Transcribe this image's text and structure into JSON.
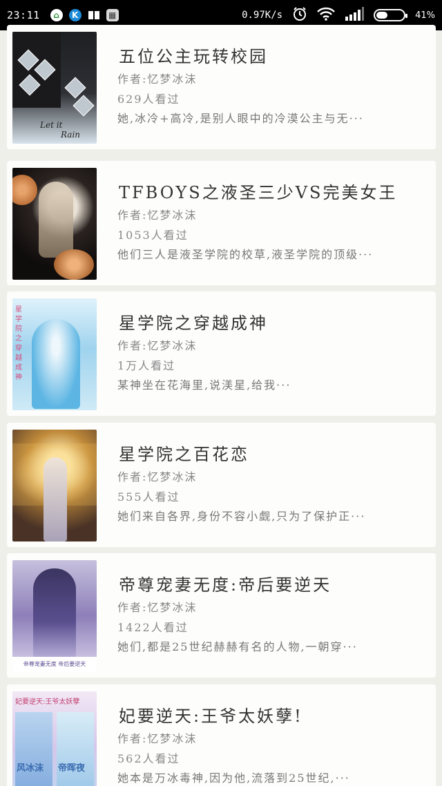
{
  "status_bar": {
    "time": "23:11",
    "net_speed": "0.97K/s",
    "battery_percent": 41,
    "battery_text": "41%"
  },
  "books": [
    {
      "title": "五位公主玩转校园",
      "author": "作者:忆梦冰沫",
      "views": "629人看过",
      "desc": "她,冰冷+高冷,是别人眼中的冷漠公主与无···",
      "cover_text": [
        "Let it",
        "Rain"
      ]
    },
    {
      "title": "TFBOYS之液圣三少VS完美女王",
      "author": "作者:忆梦冰沫",
      "views": "1053人看过",
      "desc": "他们三人是液圣学院的校草,液圣学院的顶级···"
    },
    {
      "title": "星学院之穿越成神",
      "author": "作者:忆梦冰沫",
      "views": "1万人看过",
      "desc": "某神坐在花海里,说渼星,给我···",
      "cover_text": [
        "星学院之穿越成神"
      ]
    },
    {
      "title": "星学院之百花恋",
      "author": "作者:忆梦冰沫",
      "views": "555人看过",
      "desc": "她们来自各界,身份不容小觑,只为了保护正···"
    },
    {
      "title": "帝尊宠妻无度:帝后要逆天",
      "author": "作者:忆梦冰沫",
      "views": "1422人看过",
      "desc": "她们,都是25世纪赫赫有名的人物,一朝穿···",
      "cover_text": [
        "帝尊宠妻无度 帝后要逆天"
      ]
    },
    {
      "title": "妃要逆天:王爷太妖孽!",
      "author": "作者:忆梦冰沫",
      "views": "562人看过",
      "desc": "她本是万冰毒神,因为他,流落到25世纪,···",
      "cover_text": [
        "妃要逆天:王爷太妖孽",
        "风冰沫",
        "帝晖夜"
      ]
    }
  ]
}
